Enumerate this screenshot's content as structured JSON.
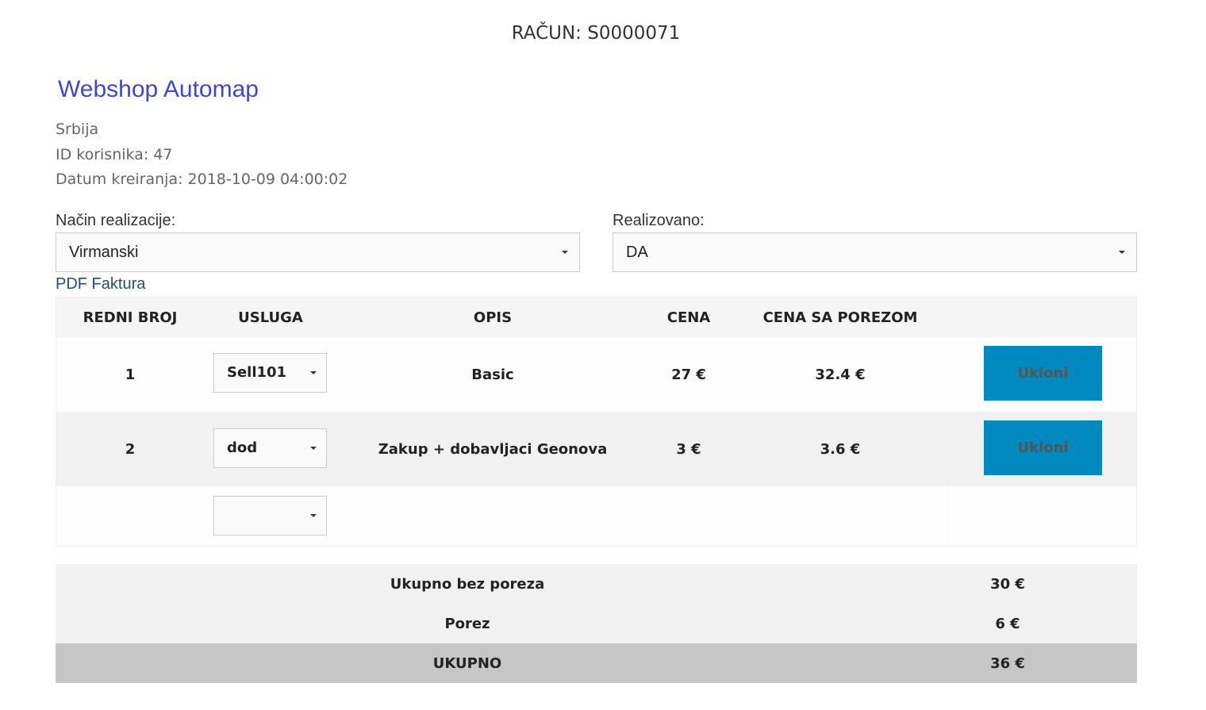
{
  "invoice": {
    "title": "RAČUN: S0000071",
    "shop_name": "Webshop Automap",
    "country": "Srbija",
    "customer_id": "ID korisnika: 47",
    "created": "Datum kreiranja: 2018-10-09 04:00:02"
  },
  "form": {
    "realization_label": "Način realizacije:",
    "realization_value": "Virmanski",
    "realized_label": "Realizovano:",
    "realized_value": "DA",
    "pdf_link": "PDF Faktura"
  },
  "table": {
    "headers": [
      "REDNI BROJ",
      "USLUGA",
      "OPIS",
      "CENA",
      "CENA SA POREZOM"
    ],
    "rows": [
      {
        "number": "1",
        "service": "Sell101",
        "description": "Basic",
        "price": "27 €",
        "price_tax": "32.4 €",
        "action": "Ukloni"
      },
      {
        "number": "2",
        "service": "dod",
        "description": "Zakup + dobavljaci Geonova",
        "price": "3 €",
        "price_tax": "3.6 €",
        "action": "Ukloni"
      }
    ],
    "new_row_service": ""
  },
  "totals": {
    "subtotal_label": "Ukupno bez poreza",
    "subtotal_value": "30 €",
    "tax_label": "Porez",
    "tax_value": "6 €",
    "total_label": "UKUPNO",
    "total_value": "36 €"
  },
  "colors": {
    "shop_name": "#3f48cc",
    "remove_button": "#0089bf",
    "pdf_link": "#1f4e79",
    "header_bg": "#f5f5f5",
    "stripe_bg": "#f1f1f1",
    "grand_total_bg": "#c6c6c6"
  },
  "icons": {
    "select_caret": "caret-down-icon"
  }
}
